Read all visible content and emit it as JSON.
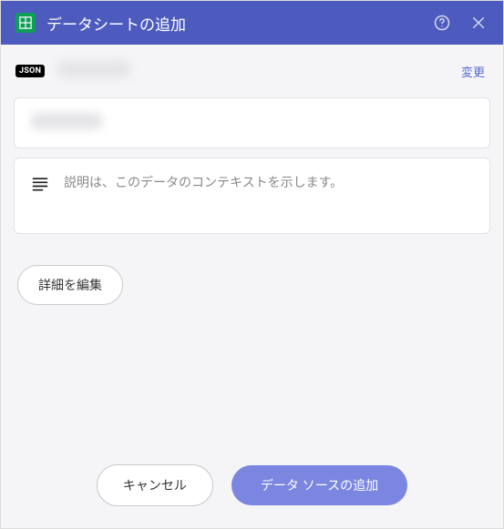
{
  "header": {
    "title": "データシートの追加"
  },
  "source": {
    "badge": "JSON",
    "change_link": "変更"
  },
  "description": {
    "placeholder": "説明は、このデータのコンテキストを示します。"
  },
  "buttons": {
    "edit_details": "詳細を編集",
    "cancel": "キャンセル",
    "add_data_source": "データ ソースの追加"
  }
}
